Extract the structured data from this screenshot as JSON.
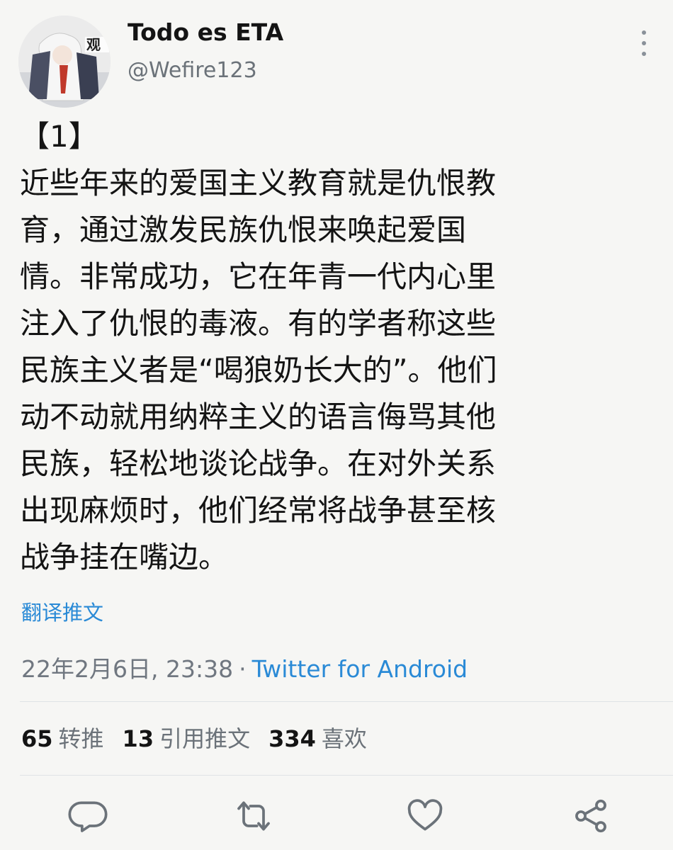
{
  "author": {
    "display_name": "Todo es ETA",
    "handle": "@Wefire123",
    "avatar_text": "观"
  },
  "tweet": {
    "lines": [
      "【1】",
      "近些年来的爱国主义教育就是仇恨教",
      "育，通过激发民族仇恨来唤起爱国",
      "情。非常成功，它在年青一代内心里",
      "注入了仇恨的毒液。有的学者称这些",
      "民族主义者是“喝狼奶长大的”。他们",
      "动不动就用纳粹主义的语言侮骂其他",
      "民族，轻松地谈论战争。在对外关系",
      "出现麻烦时，他们经常将战争甚至核",
      "战争挂在嘴边。"
    ],
    "translate_label": "翻译推文",
    "timestamp": "22年2月6日, 23:38",
    "separator": "·",
    "source": "Twitter for Android"
  },
  "stats": {
    "retweets_count": "65",
    "retweets_label": "转推",
    "quotes_count": "13",
    "quotes_label": "引用推文",
    "likes_count": "334",
    "likes_label": "喜欢"
  },
  "colors": {
    "link": "#2a8ad6",
    "muted": "#6b7279",
    "background": "#f6f6f4"
  },
  "icons": {
    "more": "more-vertical-icon",
    "reply": "reply-icon",
    "retweet": "retweet-icon",
    "like": "heart-icon",
    "share": "share-icon"
  }
}
